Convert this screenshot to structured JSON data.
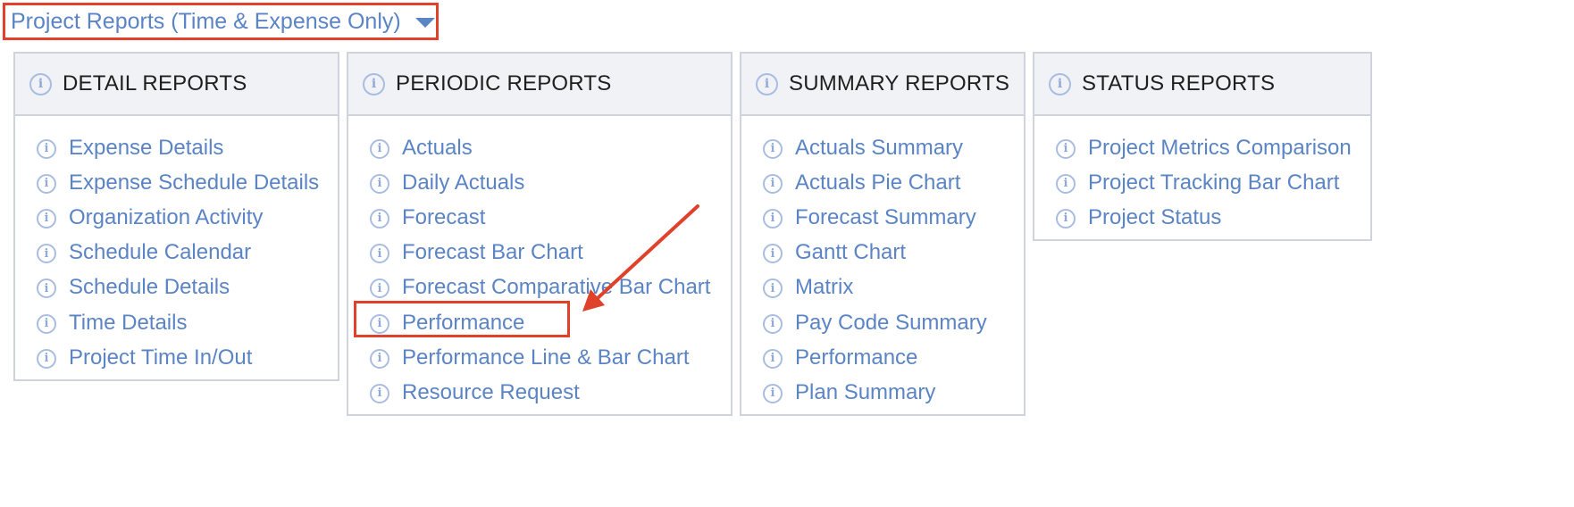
{
  "report_type_dropdown": {
    "label": "Project Reports (Time & Expense Only)",
    "caret_icon": "chevron-down-icon"
  },
  "panels": [
    {
      "title": "DETAIL REPORTS",
      "items": [
        "Expense Details",
        "Expense Schedule Details",
        "Organization Activity",
        "Schedule Calendar",
        "Schedule Details",
        "Time Details",
        "Project Time In/Out"
      ]
    },
    {
      "title": "PERIODIC REPORTS",
      "items": [
        "Actuals",
        "Daily Actuals",
        "Forecast",
        "Forecast Bar Chart",
        "Forecast Comparative Bar Chart",
        "Performance",
        "Performance Line & Bar Chart",
        "Resource Request"
      ]
    },
    {
      "title": "SUMMARY REPORTS",
      "items": [
        "Actuals Summary",
        "Actuals Pie Chart",
        "Forecast Summary",
        "Gantt Chart",
        "Matrix",
        "Pay Code Summary",
        "Performance",
        "Plan Summary"
      ]
    },
    {
      "title": "STATUS REPORTS",
      "items": [
        "Project Metrics Comparison",
        "Project Tracking Bar Chart",
        "Project Status"
      ]
    }
  ],
  "colors": {
    "link": "#5b84c4",
    "annotation": "#e0412b",
    "header_bg": "#f1f2f5",
    "border": "#cfd3db"
  },
  "icons": {
    "info": "info-circle-icon"
  }
}
